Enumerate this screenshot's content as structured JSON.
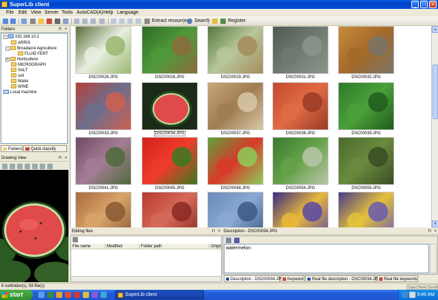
{
  "window": {
    "title": "SuperLib client"
  },
  "menu": [
    "File",
    "Edit",
    "View",
    "Server",
    "Tools",
    "AutoCAD(A)",
    "Help",
    "Language"
  ],
  "toolbar": {
    "extract_label": "Extract resource",
    "search_label": "Search",
    "register_label": "Register"
  },
  "folders_panel": {
    "title": "Folders",
    "tree": [
      {
        "label": "192.168.10.2",
        "kind": "server",
        "expander": "-"
      },
      {
        "label": "ARRIS",
        "kind": "folder",
        "expander": ""
      },
      {
        "label": "Broadacre Agriculture",
        "kind": "folder",
        "expander": "-"
      },
      {
        "label": "FLUID FERT",
        "kind": "folder",
        "expander": ""
      },
      {
        "label": "Horticulture",
        "kind": "folder",
        "expander": "+"
      },
      {
        "label": "MICROGRAPH",
        "kind": "folder",
        "expander": ""
      },
      {
        "label": "SALT",
        "kind": "folder",
        "expander": ""
      },
      {
        "label": "soil",
        "kind": "folder",
        "expander": ""
      },
      {
        "label": "Water",
        "kind": "folder",
        "expander": ""
      },
      {
        "label": "WINE",
        "kind": "folder",
        "expander": ""
      },
      {
        "label": "Local machine",
        "kind": "pc",
        "expander": ""
      }
    ],
    "tabs": [
      "Folders",
      "Quick classify"
    ]
  },
  "drawing_view": {
    "title": "Drawing View"
  },
  "thumbnails": [
    {
      "file": "DSC00026.JPG",
      "colors": [
        "#5a6e3a",
        "#e8efe0",
        "#9bb870"
      ]
    },
    {
      "file": "DSC00028.JPG",
      "colors": [
        "#2f6b25",
        "#4f9a3a",
        "#8a6c3c"
      ]
    },
    {
      "file": "DSC00029.JPG",
      "colors": [
        "#567a3e",
        "#b8c79a",
        "#a58c5d"
      ]
    },
    {
      "file": "DSC00031.JPG",
      "colors": [
        "#4e5a52",
        "#6f7a70",
        "#8b958b"
      ]
    },
    {
      "file": "DSC00032.JPG",
      "colors": [
        "#c78a3a",
        "#a46a2a",
        "#7a7568"
      ]
    },
    {
      "file": "DSC00033.JPG",
      "colors": [
        "#b4413a",
        "#6d6e8c",
        "#d06050"
      ]
    },
    {
      "file": "DSC00034.JPG",
      "colors": [
        "#234d1d",
        "#e04a4a",
        "#f26b6b"
      ]
    },
    {
      "file": "DSC00037.JPG",
      "colors": [
        "#c6a77a",
        "#a07c53",
        "#d8c8a6"
      ]
    },
    {
      "file": "DSC00038.JPG",
      "colors": [
        "#c24a2e",
        "#e16b45",
        "#9a3b26"
      ]
    },
    {
      "file": "DSC00039.JPG",
      "colors": [
        "#2f7a2a",
        "#4aa03a",
        "#225d1e"
      ]
    },
    {
      "file": "DSC00041.JPG",
      "colors": [
        "#6e4a64",
        "#a57c95",
        "#4d6c3a"
      ]
    },
    {
      "file": "DSC00045.JPG",
      "colors": [
        "#d4231b",
        "#ef3b2a",
        "#3a7a22"
      ]
    },
    {
      "file": "DSC00048.JPG",
      "colors": [
        "#5fa13b",
        "#d83a2a",
        "#8ccd59"
      ]
    },
    {
      "file": "DSC00054.JPG",
      "colors": [
        "#3a7a30",
        "#66a24a",
        "#b9c6a8"
      ]
    },
    {
      "file": "DSC00059.JPG",
      "colors": [
        "#4c6a2e",
        "#6a8a3e",
        "#3a4d24"
      ]
    },
    {
      "file": "",
      "colors": [
        "#a86a3e",
        "#d9a46a",
        "#8a5a34"
      ]
    },
    {
      "file": "",
      "colors": [
        "#b83a2e",
        "#d66a5a",
        "#8a2a24"
      ]
    },
    {
      "file": "",
      "colors": [
        "#6a8ab8",
        "#8aaad4",
        "#3a5a84"
      ]
    },
    {
      "file": "",
      "colors": [
        "#3a2a84",
        "#e8b83a",
        "#5a4aa4"
      ]
    },
    {
      "file": "",
      "colors": [
        "#4a3a8a",
        "#e4c23a",
        "#6a5ab0"
      ]
    }
  ],
  "selected_file": "DSC00034.JPG",
  "editing_panel": {
    "title": "Editing files",
    "columns": [
      "File name",
      "Modified",
      "Folder path",
      "Origin"
    ]
  },
  "description_panel": {
    "title": "Description - DSC00034.JPG",
    "text": "watermelon",
    "tabs": [
      "Description - DSC00034.JPG",
      "Keyword",
      "Real file description - DSC00034.JPG",
      "Real file keywords"
    ]
  },
  "status": {
    "left": "8 subfolder(s), 59 file(s)",
    "caps": "Caps",
    "num": "Num",
    "scroll": "Scroll"
  },
  "taskbar": {
    "start": "start",
    "task": "SuperLib client",
    "time": "9:46 AM"
  },
  "colors": {
    "accent": "#0043c6",
    "selection": "#316ac5",
    "watermelon_flesh": "#e04a4a",
    "watermelon_rind": "#234d1d"
  }
}
